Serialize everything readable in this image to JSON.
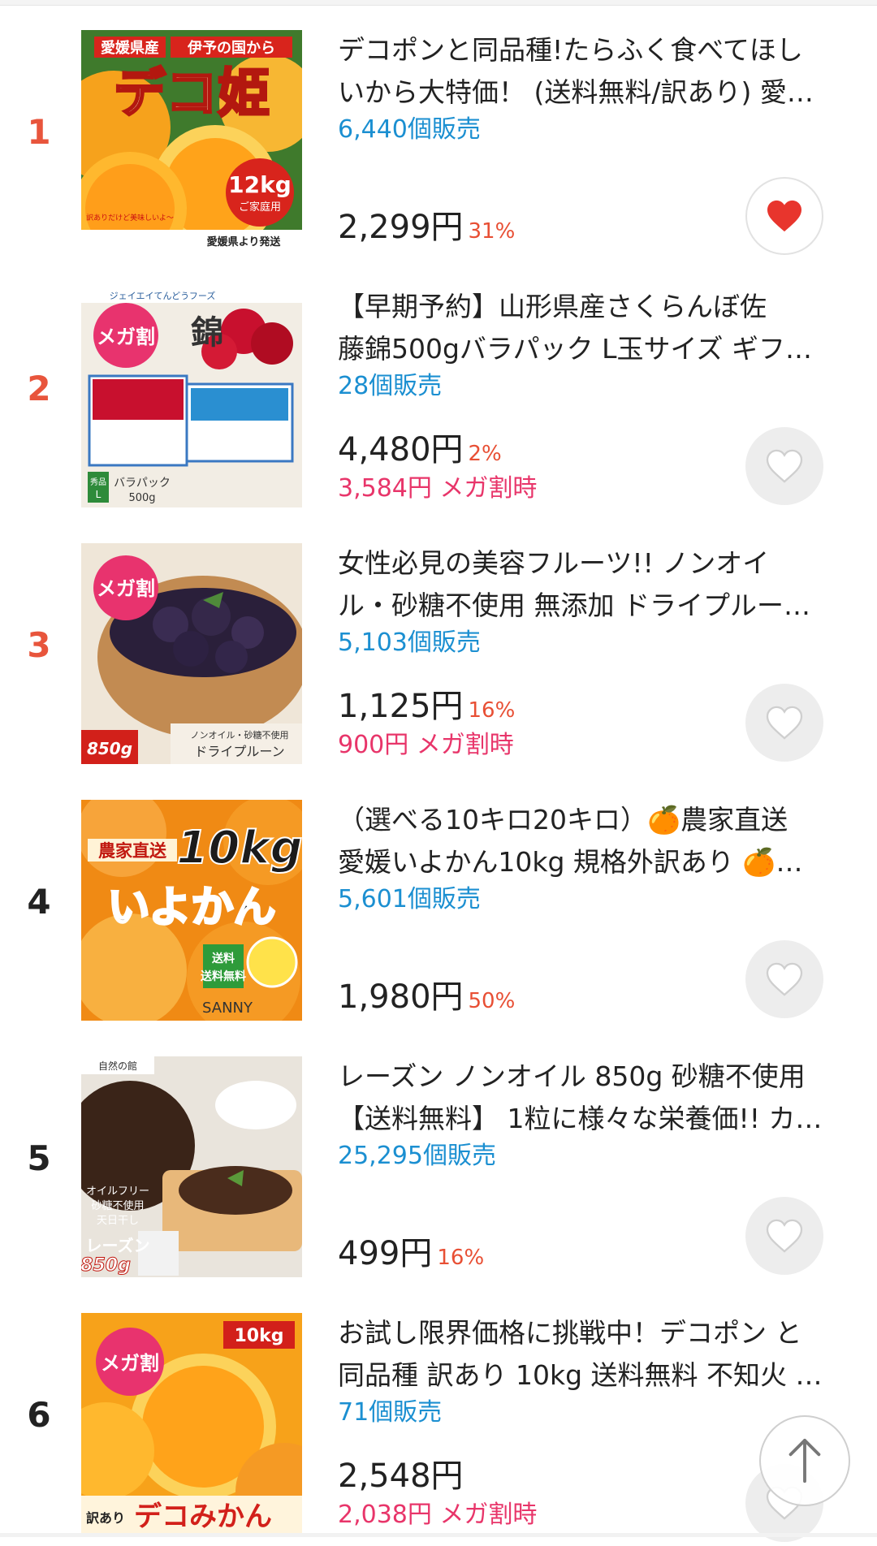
{
  "items": [
    {
      "rank": "1",
      "title1": "デコポンと同品種!たらふく食べてほし",
      "title2": "いから大特価！ (送料無料/訳あり) 愛…",
      "sold": "6,440個販売",
      "price": "2,299円",
      "rate": "31%",
      "mega": "",
      "liked": true,
      "img_text": [
        "愛媛県産",
        "伊予の国から",
        "デコ姫",
        "12kg",
        "ご家庭用",
        "愛媛県より発送",
        "訳ありだけど美味しいよ〜"
      ]
    },
    {
      "rank": "2",
      "title1": "【早期予約】山形県産さくらんぼ佐",
      "title2": "藤錦500gバラパック L玉サイズ ギフ…",
      "sold": "28個販売",
      "price": "4,480円",
      "rate": "2%",
      "mega": "3,584円 メガ割時",
      "liked": false,
      "img_text": [
        "ジェイエイてんどうフーズ",
        "メガ割",
        "錦",
        "秀品",
        "L",
        "バラパック",
        "500g"
      ]
    },
    {
      "rank": "3",
      "title1": "女性必見の美容フルーツ!! ノンオイ",
      "title2": "ル・砂糖不使用 無添加 ドライプルー…",
      "sold": "5,103個販売",
      "price": "1,125円",
      "rate": "16%",
      "mega": "900円 メガ割時",
      "liked": false,
      "img_text": [
        "メガ割",
        "ノンオイル・砂糖不使用",
        "ドライプルーン",
        "850g"
      ]
    },
    {
      "rank": "4",
      "title1": "（選べる10キロ20キロ）🍊農家直送",
      "title2": "愛媛いよかん10kg 規格外訳あり 🍊…",
      "sold": "5,601個販売",
      "price": "1,980円",
      "rate": "50%",
      "mega": "",
      "liked": false,
      "img_text": [
        "農家直送",
        "10kg",
        "いよかん",
        "送料無料",
        "SANNY"
      ]
    },
    {
      "rank": "5",
      "title1": "レーズン ノンオイル 850g 砂糖不使用",
      "title2": "【送料無料】 1粒に様々な栄養価!! カ…",
      "sold": "25,295個販売",
      "price": "499円",
      "rate": "16%",
      "mega": "",
      "liked": false,
      "img_text": [
        "自然の館",
        "オイルフリー",
        "砂糖不使用",
        "天日干し",
        "レーズン",
        "850g"
      ]
    },
    {
      "rank": "6",
      "title1": "お試し限界価格に挑戦中！デコポン と",
      "title2": "同品種 訳あり 10kg 送料無料 不知火 …",
      "sold": "71個販売",
      "price": "2,548円",
      "rate": "",
      "mega": "2,038円 メガ割時",
      "liked": false,
      "img_text": [
        "メガ割",
        "10kg",
        "訳あり",
        "デコみかん"
      ]
    }
  ],
  "colors": {
    "rank_top": "#e8553c",
    "rank_rest": "#222222",
    "sold": "#1b8fd1",
    "rate": "#e84f34",
    "mega": "#e8356a",
    "heart_on": "#e8352d",
    "heart_off": "#ffffff"
  },
  "icons": {
    "fav": "heart-icon",
    "scroll_top": "arrow-up-icon"
  }
}
